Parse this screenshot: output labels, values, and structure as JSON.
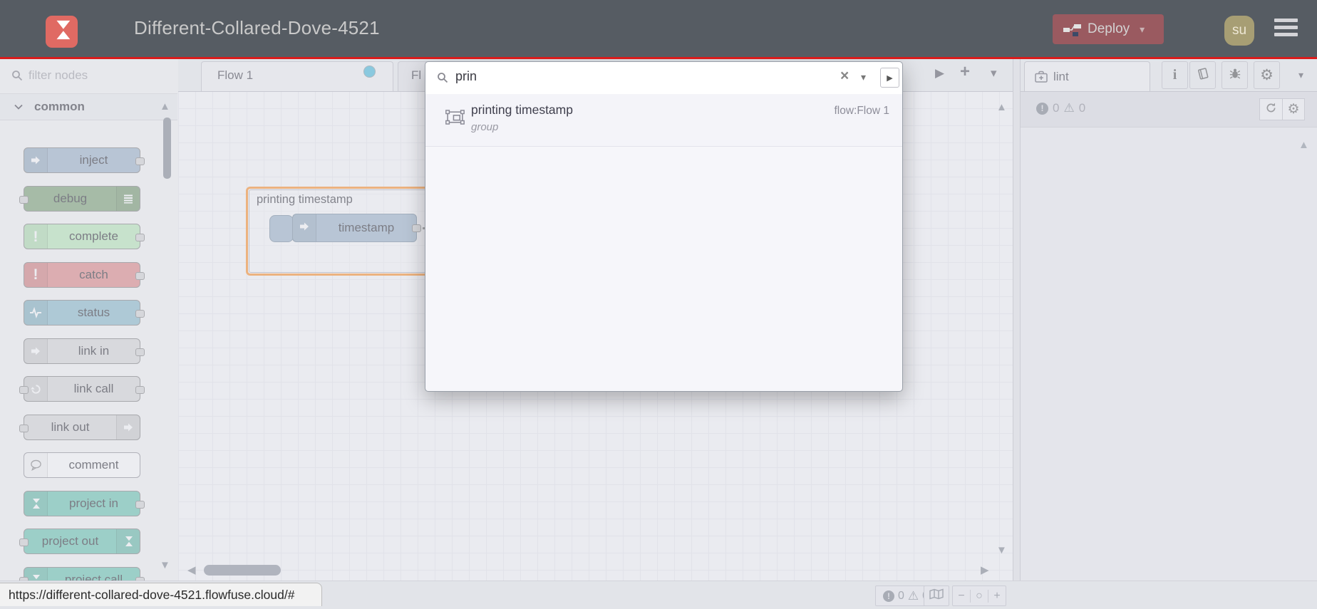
{
  "header": {
    "title": "Different-Collared-Dove-4521",
    "deploy_label": "Deploy",
    "avatar_initials": "su"
  },
  "palette": {
    "filter_placeholder": "filter nodes",
    "category_label": "common",
    "nodes": [
      {
        "label": "inject",
        "color": "#a6bbcf",
        "icon": "arrow",
        "icon_side": "left",
        "port_left": false,
        "port_right": true
      },
      {
        "label": "debug",
        "color": "#87a980",
        "icon": "lines",
        "icon_side": "right",
        "port_left": true,
        "port_right": false
      },
      {
        "label": "complete",
        "color": "#c0edc0",
        "icon": "excl",
        "icon_side": "left",
        "port_left": false,
        "port_right": true
      },
      {
        "label": "catch",
        "color": "#e49191",
        "icon": "excl",
        "icon_side": "left",
        "port_left": false,
        "port_right": true
      },
      {
        "label": "status",
        "color": "#94c1d0",
        "icon": "pulse",
        "icon_side": "left",
        "port_left": false,
        "port_right": true
      },
      {
        "label": "link in",
        "color": "#dddddd",
        "icon": "arrow",
        "icon_side": "left",
        "port_left": false,
        "port_right": true
      },
      {
        "label": "link call",
        "color": "#dddddd",
        "icon": "loop",
        "icon_side": "left",
        "port_left": true,
        "port_right": true
      },
      {
        "label": "link out",
        "color": "#dddddd",
        "icon": "arrow",
        "icon_side": "right",
        "port_left": true,
        "port_right": false
      },
      {
        "label": "comment",
        "color": "#ffffff",
        "icon": "bubble",
        "icon_side": "left",
        "port_left": false,
        "port_right": false
      },
      {
        "label": "project in",
        "color": "#76cbb8",
        "icon": "flowfuse",
        "icon_side": "left",
        "port_left": false,
        "port_right": true
      },
      {
        "label": "project out",
        "color": "#76cbb8",
        "icon": "flowfuse",
        "icon_side": "right",
        "port_left": true,
        "port_right": false
      },
      {
        "label": "project call",
        "color": "#76cbb8",
        "icon": "flowfuse",
        "icon_side": "left",
        "port_left": true,
        "port_right": true
      }
    ]
  },
  "workspace": {
    "tabs": [
      {
        "label": "Flow 1",
        "modified": true
      },
      {
        "label": "Fl",
        "modified": false
      }
    ],
    "group_label": "printing timestamp",
    "inject_node_label": "timestamp"
  },
  "search": {
    "value": "prin",
    "results": [
      {
        "title": "printing timestamp",
        "subtitle": "group",
        "flow": "flow:Flow 1"
      }
    ]
  },
  "sidebar": {
    "tab_label": "lint",
    "error_count": "0",
    "warning_count": "0"
  },
  "footer": {
    "error_count": "0",
    "warning_count": "0"
  },
  "status_url": "https://different-collared-dove-4521.flowfuse.cloud/#",
  "colors": {
    "header_bar": "#565c63",
    "accent_line": "#d91c1c",
    "deploy_bg": "#9a5a60",
    "logo_bg": "#e06a63",
    "avatar_bg": "#a79e74",
    "group_selection": "#ff9a3c",
    "modified_dot": "#57c2e0"
  },
  "icons": {
    "caret_down": "▾",
    "close": "×",
    "play_right": "▶",
    "plus": "+",
    "scroll_left": "◀",
    "scroll_right": "▶",
    "scroll_up": "▲",
    "scroll_down": "▼",
    "zoom_minus": "−",
    "zoom_reset": "○",
    "zoom_plus": "+",
    "gear": "⚙",
    "warning": "⚠",
    "info": "i"
  }
}
